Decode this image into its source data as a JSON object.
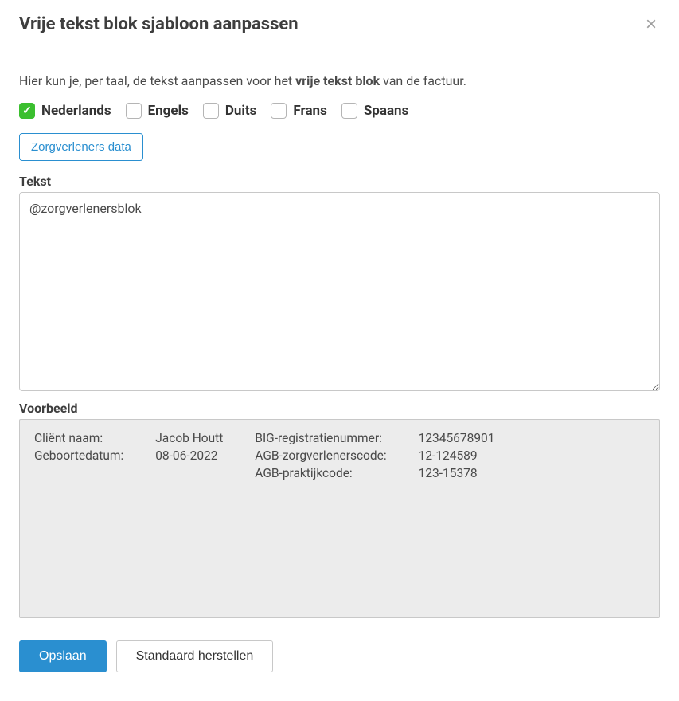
{
  "modal": {
    "title": "Vrije tekst blok sjabloon aanpassen",
    "intro_pre": "Hier kun je, per taal, de tekst aanpassen voor het ",
    "intro_bold": "vrije tekst blok",
    "intro_post": " van de factuur.",
    "languages": [
      {
        "label": "Nederlands",
        "checked": true
      },
      {
        "label": "Engels",
        "checked": false
      },
      {
        "label": "Duits",
        "checked": false
      },
      {
        "label": "Frans",
        "checked": false
      },
      {
        "label": "Spaans",
        "checked": false
      }
    ],
    "zorgverleners_button": "Zorgverleners data",
    "tekst_label": "Tekst",
    "tekst_value": "@zorgverlenersblok",
    "voorbeeld_label": "Voorbeeld",
    "preview_left": [
      {
        "label": "Cliënt naam:",
        "value": "Jacob Houtt"
      },
      {
        "label": "Geboortedatum:",
        "value": "08-06-2022"
      }
    ],
    "preview_right": [
      {
        "label": "BIG-registratienummer:",
        "value": "12345678901"
      },
      {
        "label": "AGB-zorgverlenerscode:",
        "value": "12-124589"
      },
      {
        "label": "AGB-praktijkcode:",
        "value": "123-15378"
      }
    ],
    "save_label": "Opslaan",
    "reset_label": "Standaard herstellen"
  }
}
